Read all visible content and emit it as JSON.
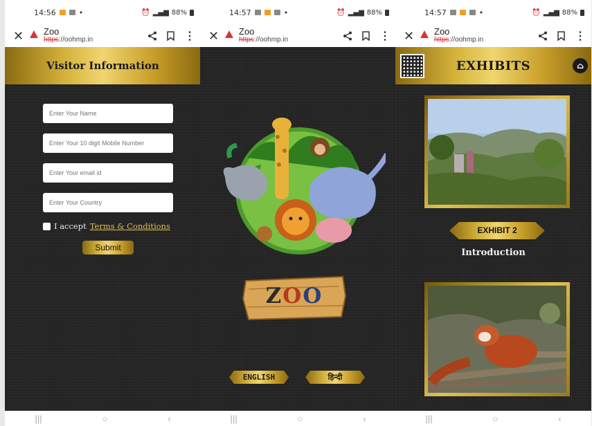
{
  "panels": [
    {
      "status": {
        "time": "14:56",
        "battery": "88%"
      },
      "browser": {
        "title": "Zoo",
        "url_scheme": "https",
        "url_rest": "://oohmp.in"
      },
      "header": "Visitor Information",
      "form": {
        "name_placeholder": "Enter Your Name",
        "mobile_placeholder": "Enter Your 10 digit Mobile Number",
        "email_placeholder": "Enter Your email id",
        "country_placeholder": "Enter Your Country",
        "accept_prefix": "I accept ",
        "terms_link": "Terms & Conditions",
        "submit_label": "Submit"
      }
    },
    {
      "status": {
        "time": "14:57",
        "battery": "88%"
      },
      "browser": {
        "title": "Zoo",
        "url_scheme": "https",
        "url_rest": "://oohmp.in"
      },
      "logo_letters": [
        "Z",
        "O",
        "O"
      ],
      "lang_english": "ENGLISH",
      "lang_hindi": "हिन्दी"
    },
    {
      "status": {
        "time": "14:57",
        "battery": "88%"
      },
      "browser": {
        "title": "Zoo",
        "url_scheme": "https",
        "url_rest": "://oohmp.in"
      },
      "header": "EXHIBITS",
      "exhibit_label": "EXHIBIT 2",
      "intro_label": "Introduction"
    }
  ],
  "nav": {
    "recents": "|||",
    "home": "○",
    "back": "‹"
  },
  "colors": {
    "gold": "#d4b13a",
    "background": "#242424",
    "link": "#e0c050",
    "warning": "#dd3333"
  },
  "icons": [
    "close-icon",
    "warning-icon",
    "share-icon",
    "bookmark-icon",
    "more-icon",
    "qr-code-icon",
    "home-icon"
  ]
}
